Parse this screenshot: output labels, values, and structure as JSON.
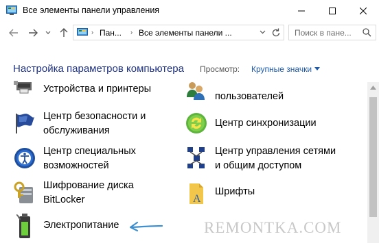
{
  "window": {
    "title": "Все элементы панели управления"
  },
  "address": {
    "crumbs": [
      "Пан...",
      "Все элементы панели ..."
    ],
    "search_placeholder": "Поиск в пане..."
  },
  "header": {
    "title": "Настройка параметров компьютера",
    "view_label": "Просмотр:",
    "view_value": "Крупные значки"
  },
  "items": [
    {
      "id": "devices",
      "lines": [
        "Устройства и принтеры"
      ],
      "icon": "printer-icon"
    },
    {
      "id": "users",
      "lines": [
        "пользователей"
      ],
      "icon": "users-icon"
    },
    {
      "id": "security",
      "lines": [
        "Центр безопасности и",
        "обслуживания"
      ],
      "icon": "flag-icon"
    },
    {
      "id": "sync",
      "lines": [
        "Центр синхронизации"
      ],
      "icon": "sync-icon"
    },
    {
      "id": "ease",
      "lines": [
        "Центр специальных",
        "возможностей"
      ],
      "icon": "accessibility-icon"
    },
    {
      "id": "network",
      "lines": [
        "Центр управления сетями",
        "и общим доступом"
      ],
      "icon": "network-icon"
    },
    {
      "id": "bitlocker",
      "lines": [
        "Шифрование диска",
        "BitLocker"
      ],
      "icon": "bitlocker-icon"
    },
    {
      "id": "fonts",
      "lines": [
        "Шрифты"
      ],
      "icon": "fonts-icon"
    },
    {
      "id": "power",
      "lines": [
        "Электропитание"
      ],
      "icon": "battery-icon"
    }
  ],
  "annotation": {
    "arrow_icon": "pointer-arrow-icon",
    "color": "#3f8fcf"
  },
  "watermark": "REMONTKA.COM"
}
